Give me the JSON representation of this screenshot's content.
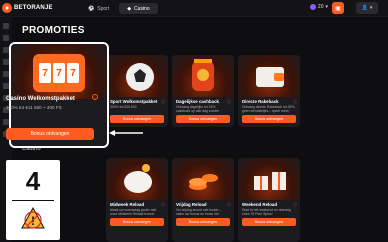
{
  "app": {
    "logo_text": "BETORANJE",
    "tabs": [
      {
        "label": "Sport",
        "icon": "ball-icon"
      },
      {
        "label": "Casino",
        "icon": "chip-icon",
        "active": true
      }
    ],
    "balance": "20"
  },
  "page": {
    "title": "PROMOTIES",
    "section_label": "Casino"
  },
  "highlight": {
    "title": "Casino Welkomstpakket",
    "desc": "300% tot €11 500 + 400 FS",
    "button": "Bonus ontvangen",
    "reels": [
      "7",
      "7",
      "7"
    ]
  },
  "cards_top": [
    {
      "title": "Sport Welkomstpakket",
      "desc": "300% tot €25 600",
      "button": "Bonus ontvangen"
    },
    {
      "title": "Dagelijkse cashback",
      "desc": "Ontvang dagelijks tot 15% cashback op alle dag zonder limieten",
      "button": "Bonus ontvangen"
    },
    {
      "title": "Directe Rakeback",
      "desc": "Ontvang directe Rakeback tot 25%, geen wervalletjes – speel meer, verdien meer!",
      "button": "Bonus ontvangen"
    }
  ],
  "cards_bottom": [
    {
      "title": "Midweek Reload",
      "desc": "Maak uw woensdag groter met onze Midweek Reload bonus!",
      "button": "Bonus ontvangen"
    },
    {
      "title": "Vrijdag Reload",
      "desc": "Vul vrijdag avond met leuker – claim uw bonus en bouw het weekend!",
      "button": "Bonus ontvangen"
    },
    {
      "title": "Weekend Reload",
      "desc": "Start in het weekend en ontvang extra 75 Free Spins!",
      "button": "Bonus ontvangen"
    }
  ],
  "step": {
    "number": "4"
  }
}
